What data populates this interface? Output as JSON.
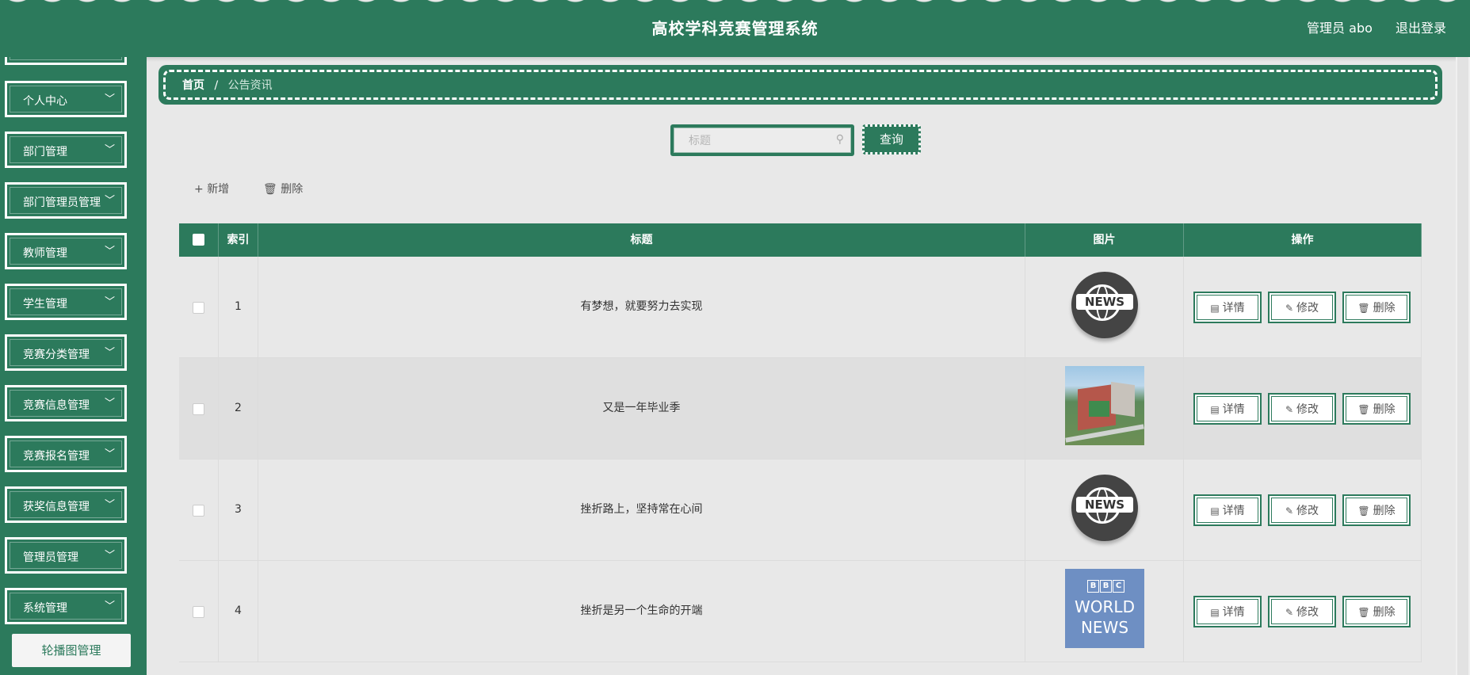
{
  "header": {
    "title": "高校学科竞赛管理系统",
    "admin": "管理员 abo",
    "logout": "退出登录"
  },
  "sidebar": {
    "items": [
      {
        "label": "个人中心"
      },
      {
        "label": "部门管理"
      },
      {
        "label": "部门管理员管理"
      },
      {
        "label": "教师管理"
      },
      {
        "label": "学生管理"
      },
      {
        "label": "竞赛分类管理"
      },
      {
        "label": "竞赛信息管理"
      },
      {
        "label": "竞赛报名管理"
      },
      {
        "label": "获奖信息管理"
      },
      {
        "label": "管理员管理"
      },
      {
        "label": "系统管理"
      }
    ],
    "sub_item": "轮播图管理",
    "chevron": "chevron-down-icon"
  },
  "breadcrumb": {
    "home": "首页",
    "separator": "/",
    "current": "公告资讯"
  },
  "search": {
    "placeholder": "标题",
    "value": "",
    "button": "查询"
  },
  "toolbar": {
    "add": "新增",
    "delete": "删除"
  },
  "table": {
    "columns": [
      "",
      "索引",
      "标题",
      "图片",
      "操作"
    ],
    "rows": [
      {
        "index": "1",
        "title": "有梦想，就要努力去实现",
        "image": "news-globe"
      },
      {
        "index": "2",
        "title": "又是一年毕业季",
        "image": "campus-photo"
      },
      {
        "index": "3",
        "title": "挫折路上，坚持常在心间",
        "image": "news-globe"
      },
      {
        "index": "4",
        "title": "挫折是另一个生命的开端",
        "image": "bbc-world-news"
      }
    ],
    "actions": {
      "detail": "详情",
      "edit": "修改",
      "delete": "删除"
    }
  },
  "images": {
    "news_word": "NEWS",
    "bbc_letters": [
      "B",
      "B",
      "C"
    ],
    "bbc_line1": "WORLD",
    "bbc_line2": "NEWS"
  },
  "colors": {
    "primary": "#2c7a5c",
    "background": "#e8e8e8"
  }
}
